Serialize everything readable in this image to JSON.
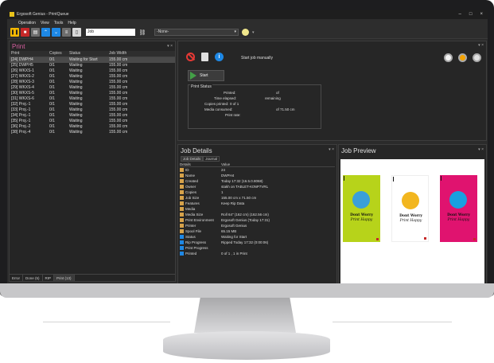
{
  "window": {
    "title": "Ergosoft Genius - PrintQueue",
    "controls": [
      "–",
      "□",
      "×"
    ]
  },
  "menu": [
    "Operation",
    "View",
    "Tools",
    "Help"
  ],
  "toolbar": {
    "search_value": "Job",
    "select_value": "-None-",
    "select_arrow": "▾",
    "link_icon": "⛓"
  },
  "print_panel": {
    "title": "Print",
    "columns": {
      "print": "Print",
      "copies": "Copies",
      "status": "Status",
      "width": "Job Width"
    },
    "rows": [
      {
        "print": "[24] DWPH4",
        "copies": "0/1",
        "status": "Waiting for Start",
        "width": "155.00 cm",
        "selected": true
      },
      {
        "print": "[25] DWPH5",
        "copies": "0/1",
        "status": "Waiting",
        "width": "155.00 cm"
      },
      {
        "print": "[26] WKXS-1",
        "copies": "0/1",
        "status": "Waiting",
        "width": "155.00 cm"
      },
      {
        "print": "[27] WKXS-2",
        "copies": "0/1",
        "status": "Waiting",
        "width": "155.00 cm"
      },
      {
        "print": "[28] WKXS-3",
        "copies": "0/1",
        "status": "Waiting",
        "width": "155.00 cm"
      },
      {
        "print": "[29] WKXS-4",
        "copies": "0/1",
        "status": "Waiting",
        "width": "155.00 cm"
      },
      {
        "print": "[30] WKXS-5",
        "copies": "0/1",
        "status": "Waiting",
        "width": "155.00 cm"
      },
      {
        "print": "[31] WKXS-6",
        "copies": "0/1",
        "status": "Waiting",
        "width": "155.00 cm"
      },
      {
        "print": "[32] Proj.-1",
        "copies": "0/1",
        "status": "Waiting",
        "width": "155.00 cm"
      },
      {
        "print": "[33] Proj.-1",
        "copies": "0/1",
        "status": "Waiting",
        "width": "155.00 cm"
      },
      {
        "print": "[34] Proj.-1",
        "copies": "0/1",
        "status": "Waiting",
        "width": "155.00 cm"
      },
      {
        "print": "[35] Proj.-1",
        "copies": "0/1",
        "status": "Waiting",
        "width": "155.00 cm"
      },
      {
        "print": "[36] Proj.-2",
        "copies": "0/1",
        "status": "Waiting",
        "width": "155.00 cm"
      },
      {
        "print": "[38] Proj.-4",
        "copies": "0/1",
        "status": "Waiting",
        "width": "155.00 cm"
      }
    ],
    "bottom_tabs": [
      "Error",
      "Done (5)",
      "RIP",
      "Print (13)"
    ]
  },
  "job_control": {
    "start_manual_label": "Start job manually",
    "start_label": "Start",
    "status_title": "Print Status",
    "fields": {
      "printed_label": "Printed:",
      "printed_value": "of",
      "elapsed_label": "Time elapsed:",
      "elapsed_value": "remaining",
      "copies_label": "Copies printed:",
      "copies_value": "0 of 1",
      "media_label": "Media consumed:",
      "media_value": "of 71.50 cm",
      "rate_label": "Print rate:"
    }
  },
  "job_details": {
    "title": "Job Details",
    "tabs": [
      "Job Details",
      "Journal"
    ],
    "col_details": "Details",
    "col_value": "Value",
    "rows": [
      {
        "key": "ID",
        "value": "24"
      },
      {
        "key": "Name",
        "value": "DWPH4"
      },
      {
        "key": "Created",
        "value": "Today 17:32 (16.5.0.8068)"
      },
      {
        "key": "Owner",
        "value": "stakh on TABLET-K0NP7VRL"
      },
      {
        "key": "Copies",
        "value": "1"
      },
      {
        "key": "Job Size",
        "value": "155.00 cm x 71.50 cm"
      },
      {
        "key": "Features",
        "value": "Keep Rip Data"
      },
      {
        "key": "Media",
        "value": ""
      },
      {
        "key": "Media Size",
        "value": "Roll 64\" (162 cm) (162.56 cm)"
      },
      {
        "key": "Print Environment",
        "value": "Ergosoft Genius (Today 17:31)"
      },
      {
        "key": "Printer",
        "value": "Ergosoft Genius"
      },
      {
        "key": "Spool File",
        "value": "65.15 MB"
      },
      {
        "key": "Status",
        "value": "Waiting for Start"
      },
      {
        "key": "Rip Progress",
        "value": "Ripped Today 17:32 (0:00:06)"
      },
      {
        "key": "Print Progress",
        "value": ""
      },
      {
        "key": "Printed",
        "value": "0 of 1 , 1 in Print"
      }
    ]
  },
  "job_preview": {
    "title": "Job Preview",
    "posters": [
      {
        "line1": "Dont Worry",
        "line2": "Print Happy",
        "bg": "#b7d31a",
        "face": "#3a9fd8"
      },
      {
        "line1": "Dont Worry",
        "line2": "Print Happy",
        "bg": "#ffffff",
        "face": "#f2b61f"
      },
      {
        "line1": "Dont Worry",
        "line2": "Print Happy",
        "bg": "#e0136f",
        "face": "#1a9fe0"
      }
    ]
  },
  "panel_controls": "▾ ×"
}
